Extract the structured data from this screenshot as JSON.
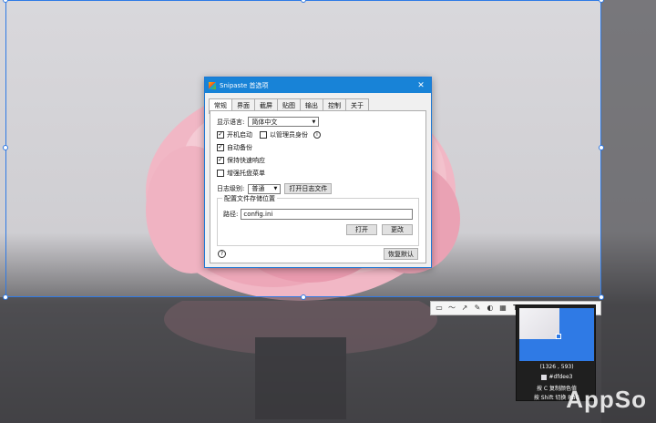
{
  "dialog": {
    "title": "Snipaste 首选项",
    "tabs": [
      "常规",
      "界面",
      "截屏",
      "贴图",
      "输出",
      "控制",
      "关于"
    ],
    "language_label": "显示语言:",
    "language_value": "简体中文",
    "autostart_label": "开机启动",
    "admin_label": "以管理员身份",
    "auto_backup_label": "自动备份",
    "quick_response_label": "保持快速响应",
    "tray_menu_label": "增强托盘菜单",
    "log_level_label": "日志级别:",
    "log_level_value": "普通",
    "open_log_label": "打开日志文件",
    "config_group_title": "配置文件存储位置",
    "path_label": "路径:",
    "path_value": "config.ini",
    "open_label": "打开",
    "change_label": "更改",
    "restore_label": "恢复默认",
    "help_glyph": "?",
    "info_glyph": "i",
    "close_glyph": "✕",
    "check_glyph": "✓"
  },
  "toolbar": {
    "tools": [
      "▭",
      "〜",
      "↗",
      "✎",
      "◐",
      "▦",
      "T",
      "↶"
    ]
  },
  "magnifier": {
    "coords": "(1326 , 593)",
    "color_hex": "#dfdee3",
    "hint_copy": "按 C 复制颜色值",
    "hint_shift": "按 Shift 切换 RBG"
  },
  "watermark": "AppSo",
  "colors": {
    "selection": "#2f7ae5",
    "titlebar": "#1883d7",
    "swatch": "#dfdee3"
  }
}
